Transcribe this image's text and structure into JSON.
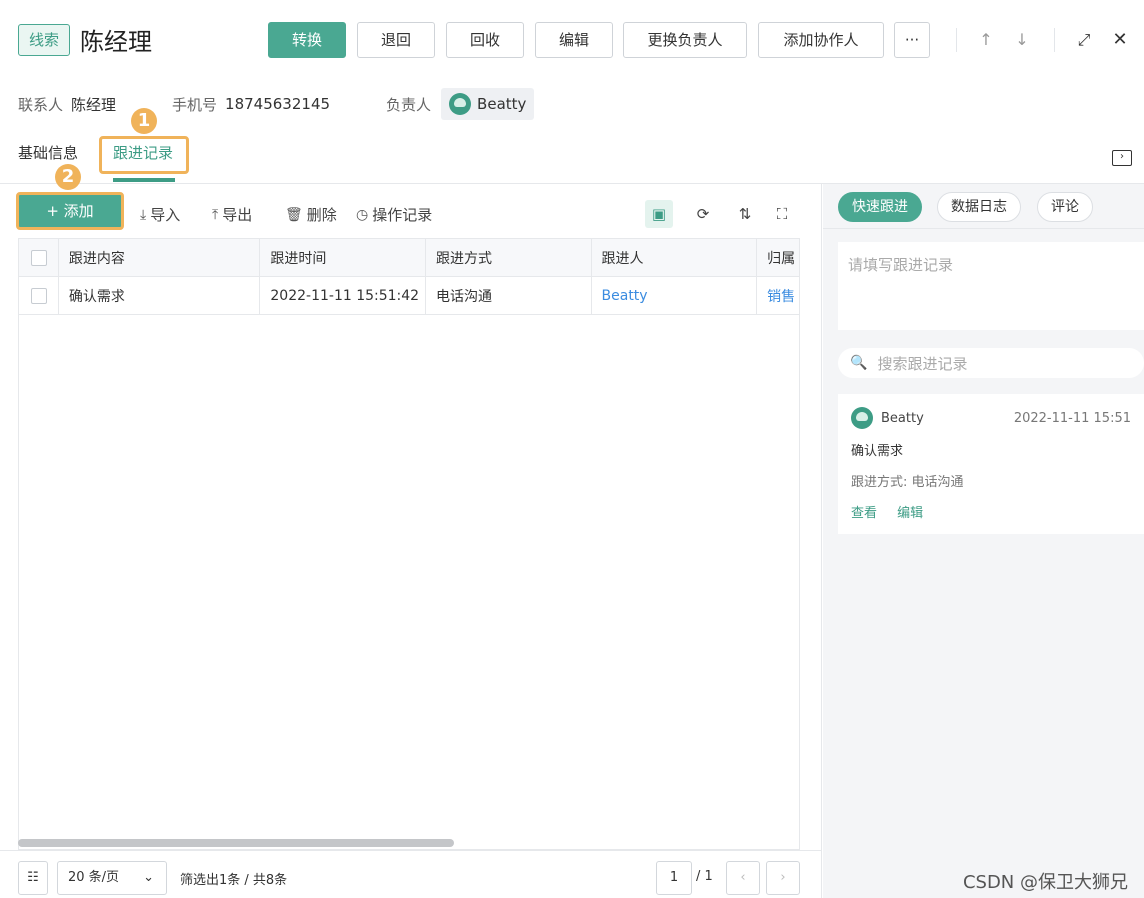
{
  "header": {
    "tag": "线索",
    "title": "陈经理",
    "buttons": {
      "convert": "转换",
      "return": "退回",
      "recycle": "回收",
      "edit": "编辑",
      "change_owner": "更换负责人",
      "add_collaborator": "添加协作人",
      "more": "···"
    },
    "icons": {
      "up": "arrow-up-icon",
      "down": "arrow-down-icon",
      "expand": "expand-icon",
      "close": "close-icon"
    }
  },
  "info": {
    "contact_label": "联系人",
    "contact_value": "陈经理",
    "phone_label": "手机号",
    "phone_value": "18745632145",
    "owner_label": "负责人",
    "owner_value": "Beatty"
  },
  "tabs": {
    "basic": "基础信息",
    "followup": "跟进记录"
  },
  "annotations": {
    "step1": "1",
    "step2": "2",
    "highlight_color": "#f0b35a"
  },
  "toolbar": {
    "add": "+ 添加",
    "import": "导入",
    "export": "导出",
    "delete": "删除",
    "log": "操作记录"
  },
  "table": {
    "columns": [
      "跟进内容",
      "跟进时间",
      "跟进方式",
      "跟进人",
      "归属"
    ],
    "rows": [
      {
        "content": "确认需求",
        "time": "2022-11-11 15:51:42",
        "method": "电话沟通",
        "person": "Beatty",
        "belong": "销售"
      }
    ]
  },
  "footer": {
    "page_size": "20 条/页",
    "summary": "筛选出1条 / 共8条",
    "page": "1",
    "total_pages": "/ 1"
  },
  "right": {
    "tabs": {
      "quick": "快速跟进",
      "datalog": "数据日志",
      "comment": "评论"
    },
    "note_placeholder": "请填写跟进记录",
    "search_placeholder": "搜索跟进记录",
    "record": {
      "user": "Beatty",
      "time": "2022-11-11 15:51",
      "content": "确认需求",
      "method": "跟进方式: 电话沟通",
      "view": "查看",
      "edit": "编辑"
    }
  },
  "watermark": "CSDN @保卫大狮兄",
  "colors": {
    "accent": "#4aa892",
    "link": "#3b8ce0"
  }
}
